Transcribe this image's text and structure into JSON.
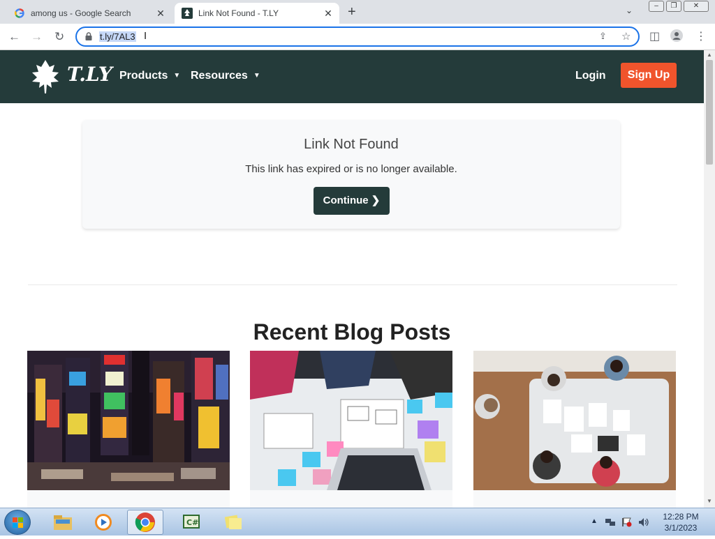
{
  "browser": {
    "tabs": [
      {
        "title": "among us - Google Search",
        "favicon": "google-icon",
        "active": false
      },
      {
        "title": "Link Not Found - T.LY",
        "favicon": "tly-icon",
        "active": true
      }
    ],
    "url": "t.ly/7AL3"
  },
  "site": {
    "logo_text": "T.LY",
    "nav": {
      "products": "Products",
      "resources": "Resources",
      "login": "Login",
      "signup": "Sign Up"
    },
    "colors": {
      "nav_bg": "#243b3a",
      "accent": "#f0542c"
    }
  },
  "notice": {
    "title": "Link Not Found",
    "message": "This link has expired or is no longer available.",
    "button": "Continue"
  },
  "blog": {
    "heading": "Recent Blog Posts"
  },
  "taskbar": {
    "time": "12:28 PM",
    "date": "3/1/2023"
  }
}
